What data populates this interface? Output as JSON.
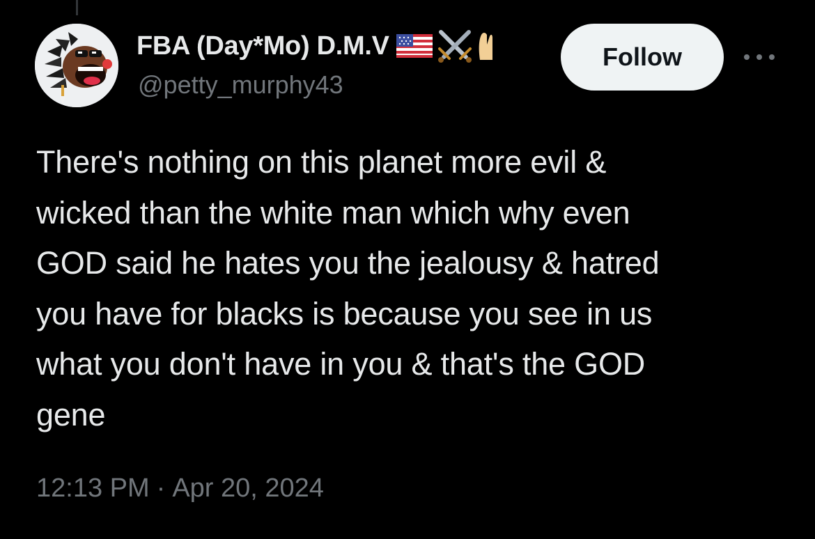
{
  "author": {
    "display_name": "FBA (Day*Mo) D.M.V",
    "name_emojis": [
      "us-flag-icon",
      "crossed-swords-icon",
      "raised-hand-icon"
    ],
    "handle": "@petty_murphy43"
  },
  "actions": {
    "follow_label": "Follow",
    "more_icon": "more-options-icon"
  },
  "tweet": {
    "text": "There's nothing on this planet more evil &\nwicked than the white man which why even\nGOD said he hates you the jealousy & hatred\nyou have for blacks is because you see in us\nwhat you don't have in you & that's the GOD\ngene",
    "time": "12:13 PM",
    "separator": "·",
    "date": "Apr 20, 2024"
  },
  "colors": {
    "background": "#000000",
    "primary_text": "#e7e9ea",
    "secondary_text": "#71767b",
    "follow_button_bg": "#eff3f4",
    "follow_button_text": "#0f1419"
  }
}
